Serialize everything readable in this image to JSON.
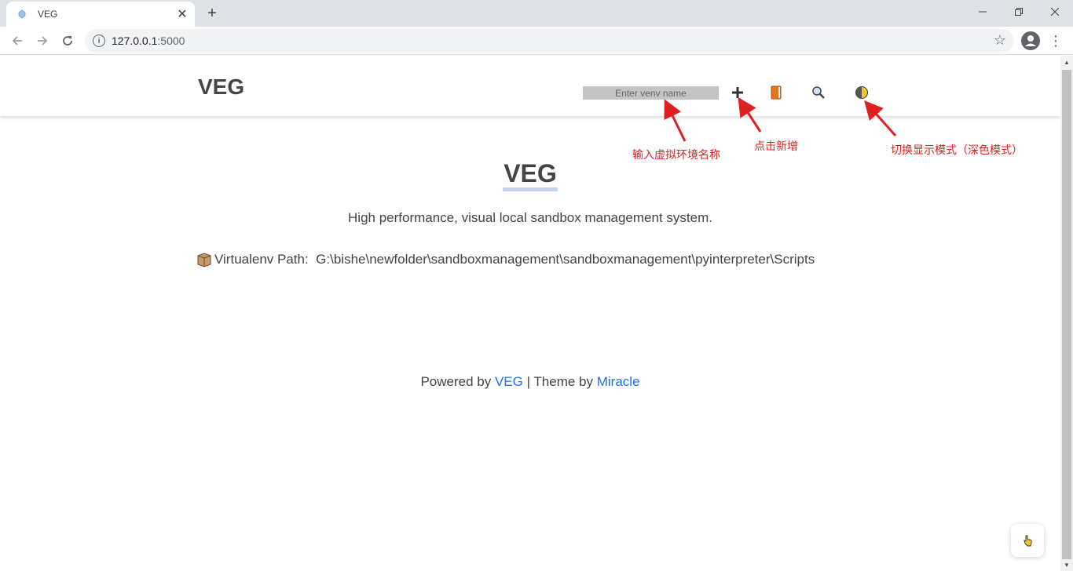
{
  "browser": {
    "tab_title": "VEG",
    "url_host": "127.0.0.1",
    "url_port": ":5000",
    "icons": [
      "back-icon",
      "forward-icon",
      "reload-icon",
      "info-icon",
      "star-icon",
      "profile-icon",
      "menu-icon"
    ]
  },
  "header": {
    "brand": "VEG",
    "venv_placeholder": "Enter venv name"
  },
  "hero": {
    "title": "VEG",
    "subtitle": "High performance, visual local sandbox management system.",
    "path_label": "Virtualenv Path:",
    "path_value": "G:\\bishe\\newfolder\\sandboxmanagement\\sandboxmanagement\\pyinterpreter\\Scripts"
  },
  "footer": {
    "powered_by": "Powered by ",
    "veg_link": "VEG",
    "separator": " | Theme by ",
    "miracle_link": "Miracle"
  },
  "annotations": {
    "input_hint": "输入虚拟环境名称",
    "add_hint": "点击新增",
    "theme_hint": "切换显示模式（深色模式）"
  },
  "colors": {
    "annotation": "#e02020",
    "link": "#1a73e8",
    "text": "#444444"
  }
}
